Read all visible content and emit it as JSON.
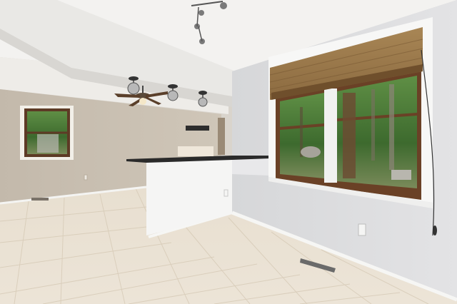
{
  "scene": {
    "description_label": "",
    "colors": {
      "wall_left": "#c9c0b2",
      "wall_right": "#dcdcde",
      "ceiling": "#f2f1ef",
      "floor": "#e7ddcd",
      "counter_top": "#2a2a2a",
      "window_frame": "#6a4126",
      "blind": "#9a7a4e",
      "foliage": "#4f7a3a",
      "baseboard": "#f4f4f2"
    },
    "icons": [
      "ceiling-fan-icon",
      "track-light-icon",
      "pendant-light-icon",
      "floor-vent-icon",
      "outlet-icon"
    ]
  }
}
